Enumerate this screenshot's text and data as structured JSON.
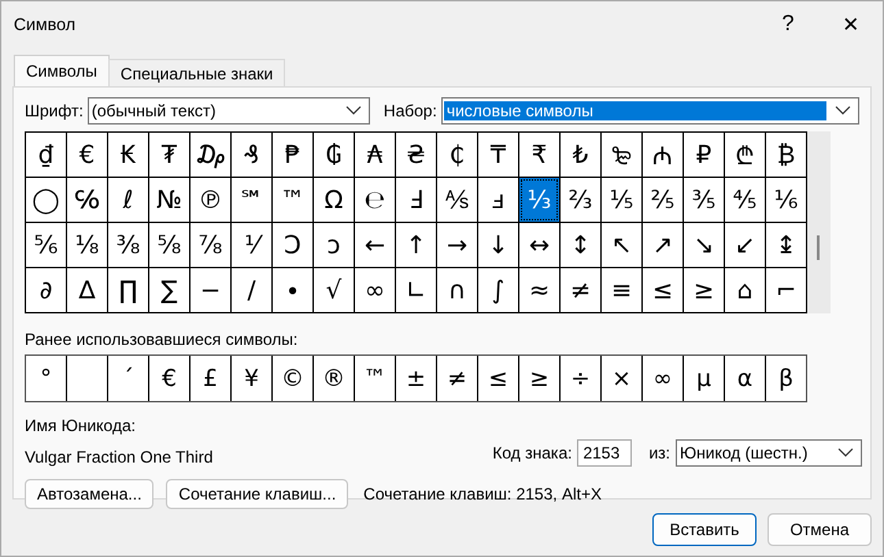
{
  "window": {
    "title": "Символ",
    "help": "?",
    "close": "✕"
  },
  "tabs": [
    {
      "label": "Символы",
      "selected": true
    },
    {
      "label": "Специальные знаки",
      "selected": false
    }
  ],
  "font_field": {
    "label": "Шрифт:",
    "value": "(обычный текст)"
  },
  "subset_field": {
    "label": "Набор:",
    "value": "числовые символы"
  },
  "symbols": [
    {
      "char": "₫",
      "selected": false
    },
    {
      "char": "€",
      "selected": false
    },
    {
      "char": "₭",
      "selected": false
    },
    {
      "char": "₮",
      "selected": false
    },
    {
      "char": "₯",
      "selected": false
    },
    {
      "char": "₰",
      "selected": false
    },
    {
      "char": "₱",
      "selected": false
    },
    {
      "char": "₲",
      "selected": false
    },
    {
      "char": "₳",
      "selected": false
    },
    {
      "char": "₴",
      "selected": false
    },
    {
      "char": "₵",
      "selected": false
    },
    {
      "char": "₸",
      "selected": false
    },
    {
      "char": "₹",
      "selected": false
    },
    {
      "char": "₺",
      "selected": false
    },
    {
      "char": "₻",
      "selected": false
    },
    {
      "char": "₼",
      "selected": false
    },
    {
      "char": "₽",
      "selected": false
    },
    {
      "char": "₾",
      "selected": false
    },
    {
      "char": "₿",
      "selected": false
    },
    {
      "char": "◯",
      "selected": false
    },
    {
      "char": "℅",
      "selected": false
    },
    {
      "char": "ℓ",
      "selected": false
    },
    {
      "char": "№",
      "selected": false
    },
    {
      "char": "℗",
      "selected": false
    },
    {
      "char": "℠",
      "selected": false
    },
    {
      "char": "™",
      "selected": false
    },
    {
      "char": "Ω",
      "selected": false
    },
    {
      "char": "℮",
      "selected": false
    },
    {
      "char": "Ⅎ",
      "selected": false
    },
    {
      "char": "⅍",
      "selected": false
    },
    {
      "char": "ⅎ",
      "selected": false
    },
    {
      "char": "⅓",
      "selected": true
    },
    {
      "char": "⅔",
      "selected": false
    },
    {
      "char": "⅕",
      "selected": false
    },
    {
      "char": "⅖",
      "selected": false
    },
    {
      "char": "⅗",
      "selected": false
    },
    {
      "char": "⅘",
      "selected": false
    },
    {
      "char": "⅙",
      "selected": false
    },
    {
      "char": "⅚",
      "selected": false
    },
    {
      "char": "⅛",
      "selected": false
    },
    {
      "char": "⅜",
      "selected": false
    },
    {
      "char": "⅝",
      "selected": false
    },
    {
      "char": "⅞",
      "selected": false
    },
    {
      "char": "⅟",
      "selected": false
    },
    {
      "char": "Ↄ",
      "selected": false
    },
    {
      "char": "ↄ",
      "selected": false
    },
    {
      "char": "←",
      "selected": false
    },
    {
      "char": "↑",
      "selected": false
    },
    {
      "char": "→",
      "selected": false
    },
    {
      "char": "↓",
      "selected": false
    },
    {
      "char": "↔",
      "selected": false
    },
    {
      "char": "↕",
      "selected": false
    },
    {
      "char": "↖",
      "selected": false
    },
    {
      "char": "↗",
      "selected": false
    },
    {
      "char": "↘",
      "selected": false
    },
    {
      "char": "↙",
      "selected": false
    },
    {
      "char": "↨",
      "selected": false
    },
    {
      "char": "∂",
      "selected": false
    },
    {
      "char": "∆",
      "selected": false
    },
    {
      "char": "∏",
      "selected": false
    },
    {
      "char": "∑",
      "selected": false
    },
    {
      "char": "−",
      "selected": false
    },
    {
      "char": "∕",
      "selected": false
    },
    {
      "char": "∙",
      "selected": false
    },
    {
      "char": "√",
      "selected": false
    },
    {
      "char": "∞",
      "selected": false
    },
    {
      "char": "∟",
      "selected": false
    },
    {
      "char": "∩",
      "selected": false
    },
    {
      "char": "∫",
      "selected": false
    },
    {
      "char": "≈",
      "selected": false
    },
    {
      "char": "≠",
      "selected": false
    },
    {
      "char": "≡",
      "selected": false
    },
    {
      "char": "≤",
      "selected": false
    },
    {
      "char": "≥",
      "selected": false
    },
    {
      "char": "⌂",
      "selected": false
    },
    {
      "char": "⌐",
      "selected": false
    }
  ],
  "recent_label": "Ранее использовавшиеся символы:",
  "recent": [
    {
      "kind": "char",
      "char": "°"
    },
    {
      "kind": "blank"
    },
    {
      "kind": "char",
      "char": "´"
    },
    {
      "kind": "char",
      "char": "€"
    },
    {
      "kind": "char",
      "char": "£"
    },
    {
      "kind": "char",
      "char": "¥"
    },
    {
      "kind": "char",
      "char": "©"
    },
    {
      "kind": "char",
      "char": "®"
    },
    {
      "kind": "char",
      "char": "™"
    },
    {
      "kind": "char",
      "char": "±"
    },
    {
      "kind": "char",
      "char": "≠"
    },
    {
      "kind": "char",
      "char": "≤"
    },
    {
      "kind": "char",
      "char": "≥"
    },
    {
      "kind": "char",
      "char": "÷"
    },
    {
      "kind": "char",
      "char": "×"
    },
    {
      "kind": "char",
      "char": "∞"
    },
    {
      "kind": "char",
      "char": "µ"
    },
    {
      "kind": "char",
      "char": "α"
    },
    {
      "kind": "char",
      "char": "β"
    }
  ],
  "unicode_name_label": "Имя Юникода:",
  "unicode_name": "Vulgar Fraction One Third",
  "code_field": {
    "label": "Код знака:",
    "value": "2153"
  },
  "from_field": {
    "label": "из:",
    "value": "Юникод (шестн.)"
  },
  "autocorrect_button": "Автозамена...",
  "shortcut_button": "Сочетание клавиш...",
  "shortcut_text": "Сочетание клавиш: 2153, Alt+X",
  "insert_button": "Вставить",
  "cancel_button": "Отмена"
}
